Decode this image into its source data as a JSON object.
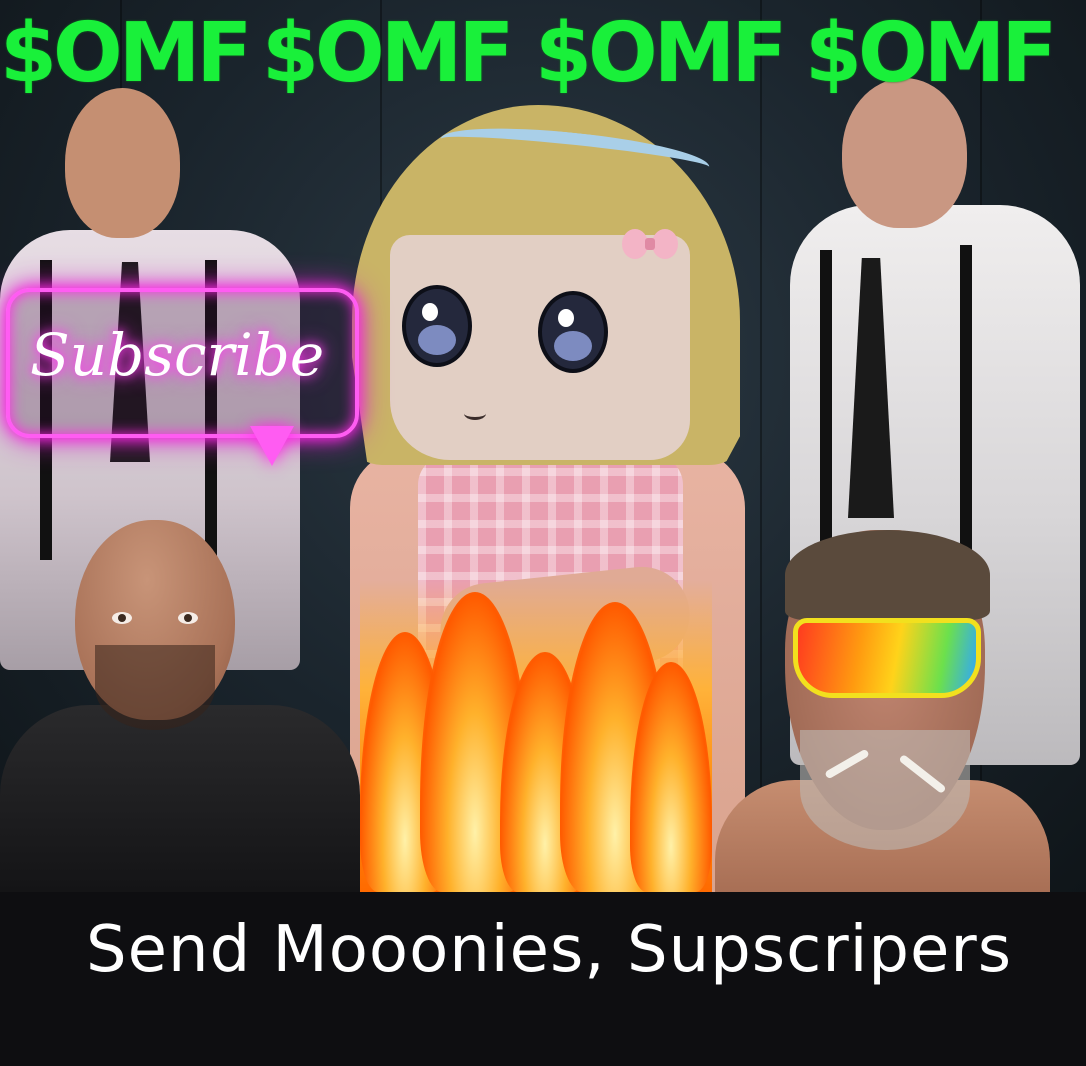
{
  "ticker": {
    "items": [
      "$OMF",
      "$OMF",
      "$OMF",
      "$OMF"
    ],
    "color": "#19f03a"
  },
  "overlay": {
    "subscribe_label": "Subscribe",
    "neon_color": "#ff5cf2"
  },
  "caption": {
    "text": "Send Mooonies, Supscripers"
  },
  "icons": {
    "bow": "pink-bow-icon",
    "fire": "fire-icon"
  }
}
